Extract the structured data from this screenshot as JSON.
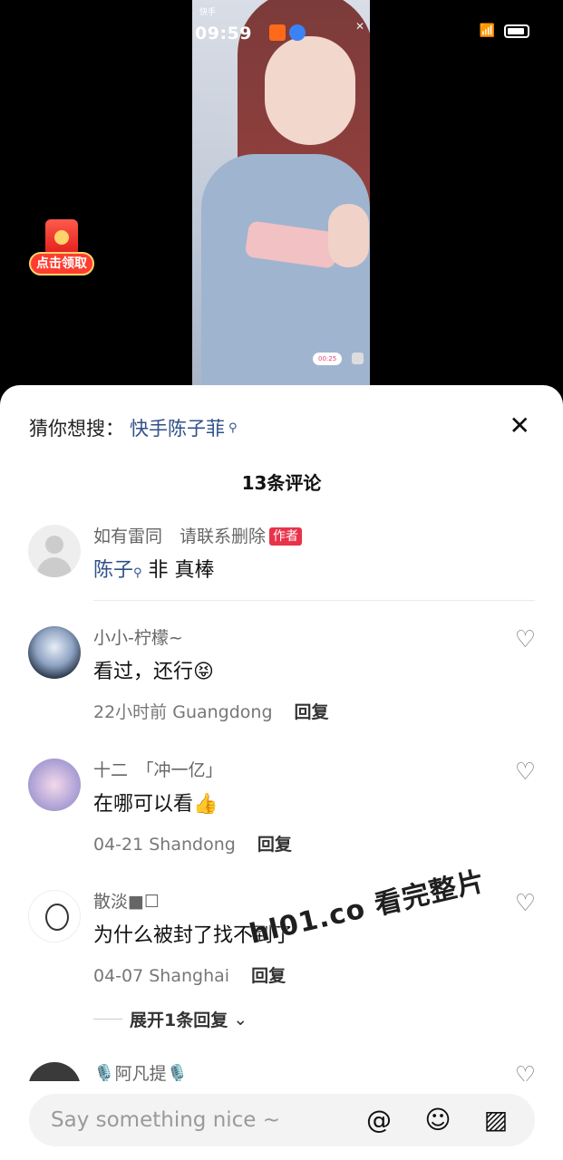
{
  "video": {
    "status_time": "09:59",
    "app_name": "快手",
    "timer": "00:25"
  },
  "red_packet": {
    "label": "点击领取"
  },
  "suggest": {
    "prefix": "猜你想搜：",
    "term": "快手陈子菲"
  },
  "comments_count": "13条评论",
  "comments": [
    {
      "name": "如有雷同　请联系删除",
      "badge": "作者",
      "text_link": "陈子",
      "text_rest": " 非 真棒"
    },
    {
      "name": "小小-柠檬~",
      "text": "看过，还行😝",
      "time": "22小时前 Guangdong",
      "reply": "回复"
    },
    {
      "name": "十二　「冲一亿」",
      "text": "在哪可以看👍",
      "time": "04-21 Shandong",
      "reply": "回复"
    },
    {
      "name": "散淡■☐",
      "text": "为什么被封了找不到了",
      "time": "04-07 Shanghai",
      "reply": "回复",
      "expand": "展开1条回复"
    },
    {
      "name": "🎙️阿凡提🎙️"
    }
  ],
  "watermark": "hl01.co 看完整片",
  "input": {
    "placeholder": "Say something nice ~"
  },
  "icons": [
    "at-icon",
    "emoji-icon",
    "image-icon",
    "heart-icon",
    "close-icon",
    "search-icon"
  ]
}
